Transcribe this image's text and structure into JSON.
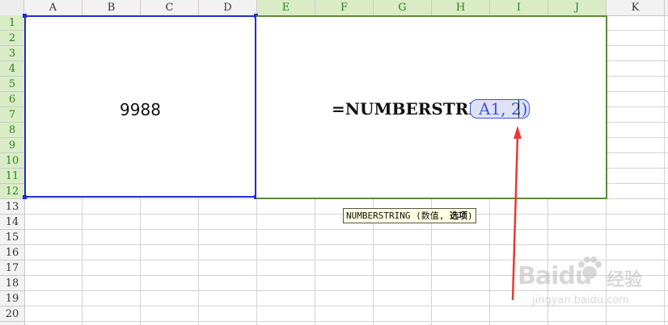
{
  "sheet": {
    "columns": [
      "A",
      "B",
      "C",
      "D",
      "E",
      "F",
      "G",
      "H",
      "I",
      "J",
      "K"
    ],
    "rows": [
      "1",
      "2",
      "3",
      "4",
      "5",
      "6",
      "7",
      "8",
      "9",
      "10",
      "11",
      "12",
      "13",
      "14",
      "15",
      "16",
      "17",
      "18",
      "19",
      "20"
    ],
    "selected_columns": [
      "E",
      "F",
      "G",
      "H",
      "I",
      "J"
    ],
    "selected_rows": [
      "1",
      "2",
      "3",
      "4",
      "5",
      "6",
      "7",
      "8",
      "9",
      "10",
      "11",
      "12"
    ]
  },
  "cell_a1": {
    "value": "9988"
  },
  "formula": {
    "function": "=NUMBERSTRING",
    "open_paren": "(",
    "args": "A1, 2",
    "close_paren": ")"
  },
  "tooltip": {
    "function": "NUMBERSTRING",
    "signature": " (数值, ",
    "current_arg": "选项",
    "end": ")"
  },
  "watermark": {
    "brand": "Baidu",
    "brand_cn": "经验",
    "url": "jingyan.baidu.com"
  },
  "colors": {
    "selection_blue": "#1f2bd6",
    "selection_green": "#5d8a3c",
    "header_selected": "#d9ecc6",
    "arrow_red": "#e53935",
    "tooltip_bg": "#ffffe1"
  }
}
